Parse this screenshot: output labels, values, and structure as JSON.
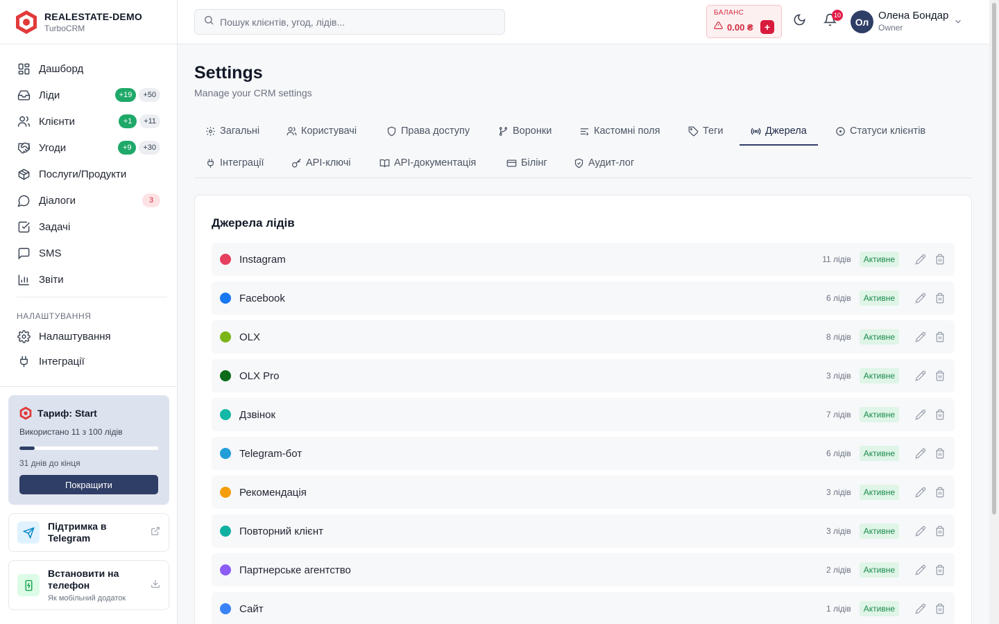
{
  "brand": {
    "name": "REALESTATE-DEMO",
    "sub": "TurboCRM"
  },
  "sidebar": {
    "items": [
      {
        "label": "Дашборд",
        "icon": "dashboard-icon"
      },
      {
        "label": "Ліди",
        "icon": "inbox-icon",
        "badge_new": "+19",
        "badge_total": "+50"
      },
      {
        "label": "Клієнти",
        "icon": "users-icon",
        "badge_new": "+1",
        "badge_total": "+11"
      },
      {
        "label": "Угоди",
        "icon": "handshake-icon",
        "badge_new": "+9",
        "badge_total": "+30"
      },
      {
        "label": "Послуги/Продукти",
        "icon": "package-icon"
      },
      {
        "label": "Діалоги",
        "icon": "chat-icon",
        "badge_alert": "3"
      },
      {
        "label": "Задачі",
        "icon": "checkbox-icon"
      },
      {
        "label": "SMS",
        "icon": "message-icon"
      },
      {
        "label": "Звіти",
        "icon": "bar-chart-icon"
      }
    ],
    "section_label": "НАЛАШТУВАННЯ",
    "settings_items": [
      {
        "label": "Налаштування",
        "icon": "gear-icon"
      },
      {
        "label": "Інтеграції",
        "icon": "plug-icon"
      }
    ],
    "plan": {
      "title": "Тариф: Start",
      "used": "Використано 11 з 100 лідів",
      "progress": 0.11,
      "days_left": "31 днів до кінця",
      "upgrade_label": "Покращити"
    },
    "promo_telegram": {
      "title": "Підтримка в Telegram"
    },
    "promo_app": {
      "title": "Встановити на телефон",
      "sub": "Як мобільний додаток"
    }
  },
  "header": {
    "search_placeholder": "Пошук клієнтів, угод, лідів...",
    "balance_label": "БАЛАНС",
    "balance_value": "0.00 ₴",
    "balance_add": "+",
    "notifications": "10",
    "user_initials": "Ол",
    "user_name": "Олена Бондар",
    "user_role": "Owner"
  },
  "page": {
    "title": "Settings",
    "subtitle": "Manage your CRM settings",
    "tabs": [
      {
        "label": "Загальні",
        "icon": "gear-icon"
      },
      {
        "label": "Користувачі",
        "icon": "users-icon"
      },
      {
        "label": "Права доступу",
        "icon": "shield-icon"
      },
      {
        "label": "Воронки",
        "icon": "git-branch-icon"
      },
      {
        "label": "Кастомні поля",
        "icon": "list-icon"
      },
      {
        "label": "Теги",
        "icon": "tag-icon"
      },
      {
        "label": "Джерела",
        "icon": "radio-icon",
        "active": true
      },
      {
        "label": "Статуси клієнтів",
        "icon": "circle-dot-icon"
      },
      {
        "label": "Інтеграції",
        "icon": "plug-icon"
      },
      {
        "label": "API-ключі",
        "icon": "key-icon"
      },
      {
        "label": "API-документація",
        "icon": "book-icon"
      },
      {
        "label": "Білінг",
        "icon": "card-icon"
      },
      {
        "label": "Аудит-лог",
        "icon": "shield-check-icon"
      }
    ]
  },
  "sources": {
    "title": "Джерела лідів",
    "rows": [
      {
        "name": "Instagram",
        "count": "11 лідів",
        "status": "Активне",
        "color": "#e5405e"
      },
      {
        "name": "Facebook",
        "count": "6 лідів",
        "status": "Активне",
        "color": "#1877f2"
      },
      {
        "name": "OLX",
        "count": "8 лідів",
        "status": "Активне",
        "color": "#7cb518"
      },
      {
        "name": "OLX Pro",
        "count": "3 лідів",
        "status": "Активне",
        "color": "#0b6b1a"
      },
      {
        "name": "Дзвінок",
        "count": "7 лідів",
        "status": "Активне",
        "color": "#14b8a6"
      },
      {
        "name": "Telegram-бот",
        "count": "6 лідів",
        "status": "Активне",
        "color": "#229ed9"
      },
      {
        "name": "Рекомендація",
        "count": "3 лідів",
        "status": "Активне",
        "color": "#f59e0b"
      },
      {
        "name": "Повторний клієнт",
        "count": "3 лідів",
        "status": "Активне",
        "color": "#10b0a0"
      },
      {
        "name": "Партнерське агентство",
        "count": "2 лідів",
        "status": "Активне",
        "color": "#8b5cf6"
      },
      {
        "name": "Сайт",
        "count": "1 лідів",
        "status": "Активне",
        "color": "#3b82f6"
      }
    ]
  }
}
